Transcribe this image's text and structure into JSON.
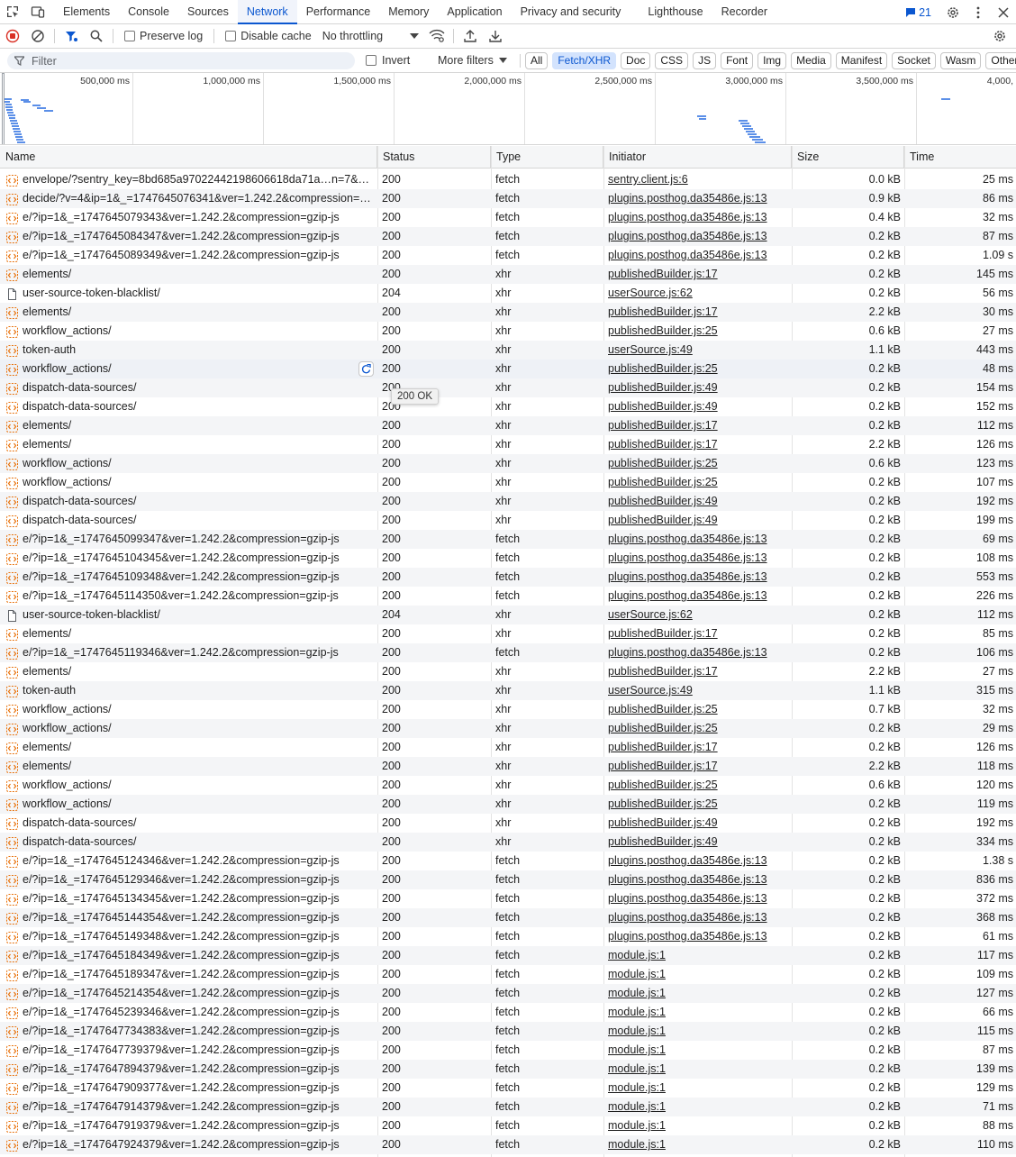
{
  "tabs": [
    {
      "label": "Elements"
    },
    {
      "label": "Console"
    },
    {
      "label": "Sources"
    },
    {
      "label": "Network",
      "active": true
    },
    {
      "label": "Performance"
    },
    {
      "label": "Memory"
    },
    {
      "label": "Application"
    },
    {
      "label": "Privacy and security"
    },
    {
      "label": "Lighthouse"
    },
    {
      "label": "Recorder"
    }
  ],
  "issues_count": "21",
  "toolbar": {
    "preserve_log": "Preserve log",
    "disable_cache": "Disable cache",
    "throttling": "No throttling"
  },
  "filter": {
    "placeholder": "Filter",
    "invert": "Invert",
    "more_filters": "More filters",
    "chips": [
      "All",
      "Fetch/XHR",
      "Doc",
      "CSS",
      "JS",
      "Font",
      "Img",
      "Media",
      "Manifest",
      "Socket",
      "Wasm",
      "Other"
    ],
    "active_chip": "Fetch/XHR"
  },
  "overview": {
    "ticks": [
      "500,000 ms",
      "1,000,000 ms",
      "1,500,000 ms",
      "2,000,000 ms",
      "2,500,000 ms",
      "3,000,000 ms",
      "3,500,000 ms",
      "4,000,"
    ]
  },
  "columns": {
    "name": "Name",
    "status": "Status",
    "type": "Type",
    "initiator": "Initiator",
    "size": "Size",
    "time": "Time"
  },
  "tooltip": "200 OK",
  "colors": {
    "accent": "#0b57d0",
    "fetch_icon": "#e8710a",
    "bar": "#5b8fe8"
  },
  "rows": [
    {
      "name": "envelope/?sentry_key=8bd685a97022442198606618da71a…n=7&…",
      "status": "200",
      "type": "fetch",
      "initiator": "sentry.client.js:6",
      "size": "0.0 kB",
      "time": "25 ms",
      "icon": "fetch"
    },
    {
      "name": "decide/?v=4&ip=1&_=1747645076341&ver=1.242.2&compression=…",
      "status": "200",
      "type": "fetch",
      "initiator": "plugins.posthog.da35486e.js:13",
      "size": "0.9 kB",
      "time": "86 ms",
      "icon": "fetch"
    },
    {
      "name": "e/?ip=1&_=1747645079343&ver=1.242.2&compression=gzip-js",
      "status": "200",
      "type": "fetch",
      "initiator": "plugins.posthog.da35486e.js:13",
      "size": "0.4 kB",
      "time": "32 ms",
      "icon": "fetch"
    },
    {
      "name": "e/?ip=1&_=1747645084347&ver=1.242.2&compression=gzip-js",
      "status": "200",
      "type": "fetch",
      "initiator": "plugins.posthog.da35486e.js:13",
      "size": "0.2 kB",
      "time": "87 ms",
      "icon": "fetch"
    },
    {
      "name": "e/?ip=1&_=1747645089349&ver=1.242.2&compression=gzip-js",
      "status": "200",
      "type": "fetch",
      "initiator": "plugins.posthog.da35486e.js:13",
      "size": "0.2 kB",
      "time": "1.09 s",
      "icon": "fetch"
    },
    {
      "name": "elements/",
      "status": "200",
      "type": "xhr",
      "initiator": "publishedBuilder.js:17",
      "size": "0.2 kB",
      "time": "145 ms",
      "icon": "fetch"
    },
    {
      "name": "user-source-token-blacklist/",
      "status": "204",
      "type": "xhr",
      "initiator": "userSource.js:62",
      "size": "0.2 kB",
      "time": "56 ms",
      "icon": "doc"
    },
    {
      "name": "elements/",
      "status": "200",
      "type": "xhr",
      "initiator": "publishedBuilder.js:17",
      "size": "2.2 kB",
      "time": "30 ms",
      "icon": "fetch"
    },
    {
      "name": "workflow_actions/",
      "status": "200",
      "type": "xhr",
      "initiator": "publishedBuilder.js:25",
      "size": "0.6 kB",
      "time": "27 ms",
      "icon": "fetch"
    },
    {
      "name": "token-auth",
      "status": "200",
      "type": "xhr",
      "initiator": "userSource.js:49",
      "size": "1.1 kB",
      "time": "443 ms",
      "icon": "fetch"
    },
    {
      "name": "workflow_actions/",
      "status": "200",
      "type": "xhr",
      "initiator": "publishedBuilder.js:25",
      "size": "0.2 kB",
      "time": "48 ms",
      "icon": "fetch",
      "hover": true
    },
    {
      "name": "dispatch-data-sources/",
      "status": "200",
      "type": "xhr",
      "initiator": "publishedBuilder.js:49",
      "size": "0.2 kB",
      "time": "154 ms",
      "icon": "fetch"
    },
    {
      "name": "dispatch-data-sources/",
      "status": "200",
      "type": "xhr",
      "initiator": "publishedBuilder.js:49",
      "size": "0.2 kB",
      "time": "152 ms",
      "icon": "fetch"
    },
    {
      "name": "elements/",
      "status": "200",
      "type": "xhr",
      "initiator": "publishedBuilder.js:17",
      "size": "0.2 kB",
      "time": "112 ms",
      "icon": "fetch"
    },
    {
      "name": "elements/",
      "status": "200",
      "type": "xhr",
      "initiator": "publishedBuilder.js:17",
      "size": "2.2 kB",
      "time": "126 ms",
      "icon": "fetch"
    },
    {
      "name": "workflow_actions/",
      "status": "200",
      "type": "xhr",
      "initiator": "publishedBuilder.js:25",
      "size": "0.6 kB",
      "time": "123 ms",
      "icon": "fetch"
    },
    {
      "name": "workflow_actions/",
      "status": "200",
      "type": "xhr",
      "initiator": "publishedBuilder.js:25",
      "size": "0.2 kB",
      "time": "107 ms",
      "icon": "fetch"
    },
    {
      "name": "dispatch-data-sources/",
      "status": "200",
      "type": "xhr",
      "initiator": "publishedBuilder.js:49",
      "size": "0.2 kB",
      "time": "192 ms",
      "icon": "fetch"
    },
    {
      "name": "dispatch-data-sources/",
      "status": "200",
      "type": "xhr",
      "initiator": "publishedBuilder.js:49",
      "size": "0.2 kB",
      "time": "199 ms",
      "icon": "fetch"
    },
    {
      "name": "e/?ip=1&_=1747645099347&ver=1.242.2&compression=gzip-js",
      "status": "200",
      "type": "fetch",
      "initiator": "plugins.posthog.da35486e.js:13",
      "size": "0.2 kB",
      "time": "69 ms",
      "icon": "fetch"
    },
    {
      "name": "e/?ip=1&_=1747645104345&ver=1.242.2&compression=gzip-js",
      "status": "200",
      "type": "fetch",
      "initiator": "plugins.posthog.da35486e.js:13",
      "size": "0.2 kB",
      "time": "108 ms",
      "icon": "fetch"
    },
    {
      "name": "e/?ip=1&_=1747645109348&ver=1.242.2&compression=gzip-js",
      "status": "200",
      "type": "fetch",
      "initiator": "plugins.posthog.da35486e.js:13",
      "size": "0.2 kB",
      "time": "553 ms",
      "icon": "fetch"
    },
    {
      "name": "e/?ip=1&_=1747645114350&ver=1.242.2&compression=gzip-js",
      "status": "200",
      "type": "fetch",
      "initiator": "plugins.posthog.da35486e.js:13",
      "size": "0.2 kB",
      "time": "226 ms",
      "icon": "fetch"
    },
    {
      "name": "user-source-token-blacklist/",
      "status": "204",
      "type": "xhr",
      "initiator": "userSource.js:62",
      "size": "0.2 kB",
      "time": "112 ms",
      "icon": "doc"
    },
    {
      "name": "elements/",
      "status": "200",
      "type": "xhr",
      "initiator": "publishedBuilder.js:17",
      "size": "0.2 kB",
      "time": "85 ms",
      "icon": "fetch"
    },
    {
      "name": "e/?ip=1&_=1747645119346&ver=1.242.2&compression=gzip-js",
      "status": "200",
      "type": "fetch",
      "initiator": "plugins.posthog.da35486e.js:13",
      "size": "0.2 kB",
      "time": "106 ms",
      "icon": "fetch"
    },
    {
      "name": "elements/",
      "status": "200",
      "type": "xhr",
      "initiator": "publishedBuilder.js:17",
      "size": "2.2 kB",
      "time": "27 ms",
      "icon": "fetch"
    },
    {
      "name": "token-auth",
      "status": "200",
      "type": "xhr",
      "initiator": "userSource.js:49",
      "size": "1.1 kB",
      "time": "315 ms",
      "icon": "fetch"
    },
    {
      "name": "workflow_actions/",
      "status": "200",
      "type": "xhr",
      "initiator": "publishedBuilder.js:25",
      "size": "0.7 kB",
      "time": "32 ms",
      "icon": "fetch"
    },
    {
      "name": "workflow_actions/",
      "status": "200",
      "type": "xhr",
      "initiator": "publishedBuilder.js:25",
      "size": "0.2 kB",
      "time": "29 ms",
      "icon": "fetch"
    },
    {
      "name": "elements/",
      "status": "200",
      "type": "xhr",
      "initiator": "publishedBuilder.js:17",
      "size": "0.2 kB",
      "time": "126 ms",
      "icon": "fetch"
    },
    {
      "name": "elements/",
      "status": "200",
      "type": "xhr",
      "initiator": "publishedBuilder.js:17",
      "size": "2.2 kB",
      "time": "118 ms",
      "icon": "fetch"
    },
    {
      "name": "workflow_actions/",
      "status": "200",
      "type": "xhr",
      "initiator": "publishedBuilder.js:25",
      "size": "0.6 kB",
      "time": "120 ms",
      "icon": "fetch"
    },
    {
      "name": "workflow_actions/",
      "status": "200",
      "type": "xhr",
      "initiator": "publishedBuilder.js:25",
      "size": "0.2 kB",
      "time": "119 ms",
      "icon": "fetch"
    },
    {
      "name": "dispatch-data-sources/",
      "status": "200",
      "type": "xhr",
      "initiator": "publishedBuilder.js:49",
      "size": "0.2 kB",
      "time": "192 ms",
      "icon": "fetch"
    },
    {
      "name": "dispatch-data-sources/",
      "status": "200",
      "type": "xhr",
      "initiator": "publishedBuilder.js:49",
      "size": "0.2 kB",
      "time": "334 ms",
      "icon": "fetch"
    },
    {
      "name": "e/?ip=1&_=1747645124346&ver=1.242.2&compression=gzip-js",
      "status": "200",
      "type": "fetch",
      "initiator": "plugins.posthog.da35486e.js:13",
      "size": "0.2 kB",
      "time": "1.38 s",
      "icon": "fetch"
    },
    {
      "name": "e/?ip=1&_=1747645129346&ver=1.242.2&compression=gzip-js",
      "status": "200",
      "type": "fetch",
      "initiator": "plugins.posthog.da35486e.js:13",
      "size": "0.2 kB",
      "time": "836 ms",
      "icon": "fetch"
    },
    {
      "name": "e/?ip=1&_=1747645134345&ver=1.242.2&compression=gzip-js",
      "status": "200",
      "type": "fetch",
      "initiator": "plugins.posthog.da35486e.js:13",
      "size": "0.2 kB",
      "time": "372 ms",
      "icon": "fetch"
    },
    {
      "name": "e/?ip=1&_=1747645144354&ver=1.242.2&compression=gzip-js",
      "status": "200",
      "type": "fetch",
      "initiator": "plugins.posthog.da35486e.js:13",
      "size": "0.2 kB",
      "time": "368 ms",
      "icon": "fetch"
    },
    {
      "name": "e/?ip=1&_=1747645149348&ver=1.242.2&compression=gzip-js",
      "status": "200",
      "type": "fetch",
      "initiator": "plugins.posthog.da35486e.js:13",
      "size": "0.2 kB",
      "time": "61 ms",
      "icon": "fetch"
    },
    {
      "name": "e/?ip=1&_=1747645184349&ver=1.242.2&compression=gzip-js",
      "status": "200",
      "type": "fetch",
      "initiator": "module.js:1",
      "size": "0.2 kB",
      "time": "117 ms",
      "icon": "fetch"
    },
    {
      "name": "e/?ip=1&_=1747645189347&ver=1.242.2&compression=gzip-js",
      "status": "200",
      "type": "fetch",
      "initiator": "module.js:1",
      "size": "0.2 kB",
      "time": "109 ms",
      "icon": "fetch"
    },
    {
      "name": "e/?ip=1&_=1747645214354&ver=1.242.2&compression=gzip-js",
      "status": "200",
      "type": "fetch",
      "initiator": "module.js:1",
      "size": "0.2 kB",
      "time": "127 ms",
      "icon": "fetch"
    },
    {
      "name": "e/?ip=1&_=1747645239346&ver=1.242.2&compression=gzip-js",
      "status": "200",
      "type": "fetch",
      "initiator": "module.js:1",
      "size": "0.2 kB",
      "time": "66 ms",
      "icon": "fetch"
    },
    {
      "name": "e/?ip=1&_=1747647734383&ver=1.242.2&compression=gzip-js",
      "status": "200",
      "type": "fetch",
      "initiator": "module.js:1",
      "size": "0.2 kB",
      "time": "115 ms",
      "icon": "fetch"
    },
    {
      "name": "e/?ip=1&_=1747647739379&ver=1.242.2&compression=gzip-js",
      "status": "200",
      "type": "fetch",
      "initiator": "module.js:1",
      "size": "0.2 kB",
      "time": "87 ms",
      "icon": "fetch"
    },
    {
      "name": "e/?ip=1&_=1747647894379&ver=1.242.2&compression=gzip-js",
      "status": "200",
      "type": "fetch",
      "initiator": "module.js:1",
      "size": "0.2 kB",
      "time": "139 ms",
      "icon": "fetch"
    },
    {
      "name": "e/?ip=1&_=1747647909377&ver=1.242.2&compression=gzip-js",
      "status": "200",
      "type": "fetch",
      "initiator": "module.js:1",
      "size": "0.2 kB",
      "time": "129 ms",
      "icon": "fetch"
    },
    {
      "name": "e/?ip=1&_=1747647914379&ver=1.242.2&compression=gzip-js",
      "status": "200",
      "type": "fetch",
      "initiator": "module.js:1",
      "size": "0.2 kB",
      "time": "71 ms",
      "icon": "fetch"
    },
    {
      "name": "e/?ip=1&_=1747647919379&ver=1.242.2&compression=gzip-js",
      "status": "200",
      "type": "fetch",
      "initiator": "module.js:1",
      "size": "0.2 kB",
      "time": "88 ms",
      "icon": "fetch"
    },
    {
      "name": "e/?ip=1&_=1747647924379&ver=1.242.2&compression=gzip-js",
      "status": "200",
      "type": "fetch",
      "initiator": "module.js:1",
      "size": "0.2 kB",
      "time": "110 ms",
      "icon": "fetch"
    }
  ]
}
